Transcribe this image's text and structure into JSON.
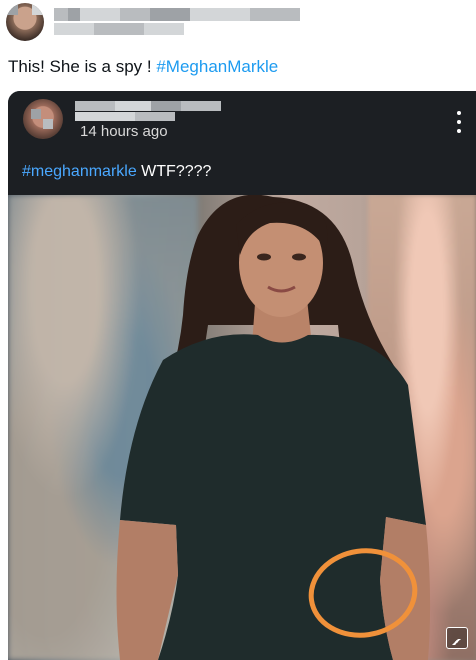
{
  "tweet": {
    "author": {
      "avatar_label": "user avatar (blurred)",
      "name_blurred": true
    },
    "text_prefix": "This!  She is a spy ! ",
    "hashtag": "#MeghanMarkle"
  },
  "quoted_post": {
    "avatar_label": "quoted user avatar (blurred)",
    "time": "14 hours ago",
    "more_icon": "more-vertical-icon",
    "hashtag": "#meghanmarkle",
    "text_suffix": " WTF????",
    "photo_icon": "image-icon",
    "colors": {
      "background": "#1c1f23",
      "hashtag": "#4aa8ff",
      "annotation_circle": "#f0913a",
      "dress": "#1f2c2c"
    }
  },
  "colors": {
    "hashtag": "#1d9bf0",
    "text": "#0f1419"
  }
}
